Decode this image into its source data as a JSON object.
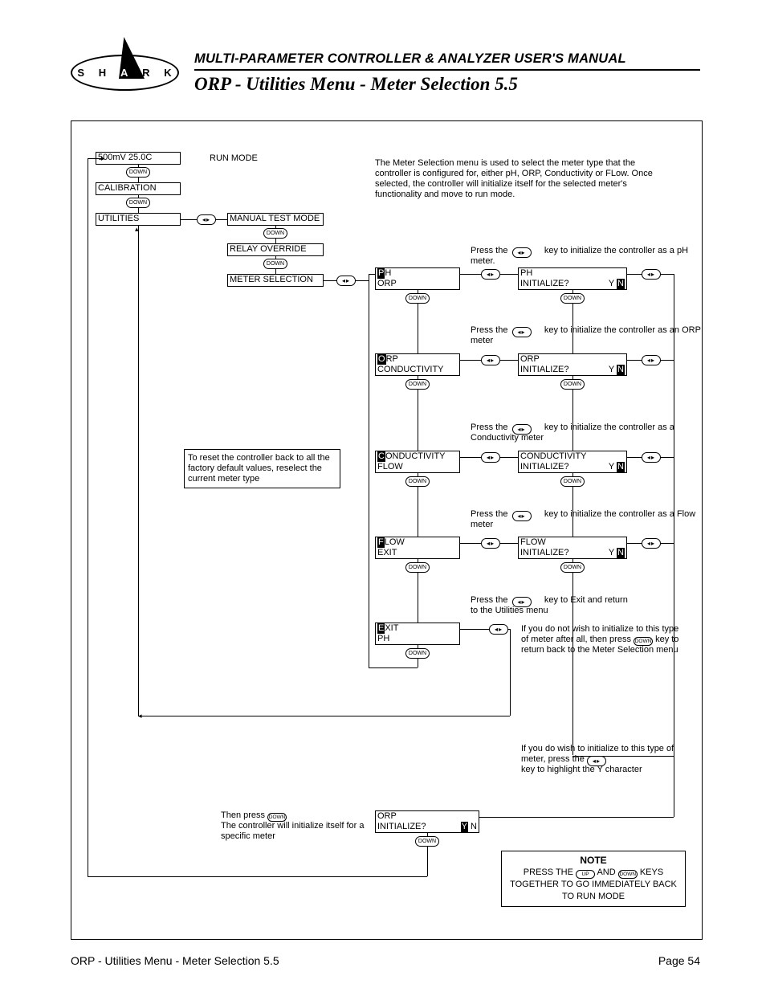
{
  "logo_letters": [
    "S",
    "H",
    "A",
    "R",
    "K"
  ],
  "header_sub": "MULTI-PARAMETER CONTROLLER & ANALYZER USER'S MANUAL",
  "page_title": "ORP - Utilities Menu - Meter Selection 5.5",
  "footer_left": "ORP - Utilities Menu - Meter Selection 5.5",
  "footer_right": "Page 54",
  "run_mode_label": "RUN MODE",
  "down_label": "DOWN",
  "up_label": "UP",
  "left_menu": {
    "lcd0_l1": "500mV  25.0C",
    "lcd1_l1": "CALIBRATION",
    "lcd2_l1": "UTILITIES"
  },
  "util_sub": {
    "manual": "MANUAL TEST MODE",
    "relay": "RELAY OVERRIDE",
    "meter": "METER SELECTION"
  },
  "intro": "The Meter Selection menu is used to select the meter type that the controller is configured for, either pH, ORP, Conductivity or FLow. Once selected, the controller will initialize itself for the selected meter's functionality and move to run mode.",
  "reset_note": "To reset the controller back to all the factory default values, reselect the current meter type",
  "rows": {
    "ph": {
      "hint": "key to initialize the controller as a pH meter.",
      "lcdA_1": "P",
      "lcdA_1b": "H",
      "lcdA_2": "ORP",
      "lcdB_1": "PH",
      "lcdB_2a": "INITIALIZE?",
      "lcdB_Y": "Y",
      "lcdB_N": "N"
    },
    "orp": {
      "hint": "key to initialize the controller as an ORP meter",
      "lcdA_1": "O",
      "lcdA_1b": "RP",
      "lcdA_2": "CONDUCTIVITY",
      "lcdB_1": "ORP",
      "lcdB_2a": "INITIALIZE?",
      "lcdB_Y": "Y",
      "lcdB_N": "N"
    },
    "cond": {
      "hint": "key to initialize the controller as a Conductivity meter",
      "lcdA_1": "C",
      "lcdA_1b": "ONDUCTIVITY",
      "lcdA_2": "FLOW",
      "lcdB_1": "CONDUCTIVITY",
      "lcdB_2a": "INITIALIZE?",
      "lcdB_Y": "Y",
      "lcdB_N": "N"
    },
    "flow": {
      "hint": "key to initialize the controller as a Flow meter",
      "lcdA_1": "F",
      "lcdA_1b": "LOW",
      "lcdA_2": "EXIT",
      "lcdB_1": "FLOW",
      "lcdB_2a": "INITIALIZE?",
      "lcdB_Y": "Y",
      "lcdB_N": "N"
    },
    "exit": {
      "hint_pre": "Press the",
      "hint": "key to Exit and return to the Utilities menu",
      "lcdA_1": "E",
      "lcdA_1b": "XIT",
      "lcdA_2": "PH",
      "side": "If you do not wish to initialize to this type of meter after all, then press",
      "side2": "key to return back to the Meter Selection menu"
    }
  },
  "press_the": "Press the",
  "confirm_note": "If you do wish to initialize to this type of meter, press the",
  "confirm_note2": "key to highlight the Y character",
  "then_press": "Then press",
  "then_press2": "The controller will initialize itself for a specific meter",
  "final_lcd": {
    "l1": "ORP",
    "l2a": "INITIALIZE?",
    "Y": "Y",
    "N": "N"
  },
  "note_title": "NOTE",
  "note_body1": "PRESS THE",
  "note_and": "AND",
  "note_body2": "KEYS TOGETHER TO GO IMMEDIATELY BACK TO RUN MODE"
}
